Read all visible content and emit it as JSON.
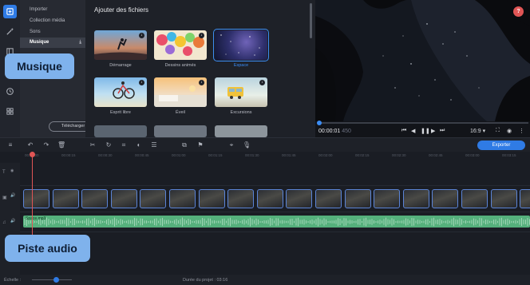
{
  "sidebar": {
    "icons": [
      "import-icon",
      "magic-wand-icon",
      "film-icon",
      "sticker-icon",
      "clock-icon",
      "grid-icon"
    ],
    "menu": [
      {
        "label": "Importer"
      },
      {
        "label": "Collection média"
      },
      {
        "label": "Sons"
      },
      {
        "label": "Musique",
        "active": true
      }
    ],
    "upload_button": "Télécharger"
  },
  "library": {
    "title": "Ajouter des fichiers",
    "tiles": [
      {
        "label": "Démarrage"
      },
      {
        "label": "Dessins animés"
      },
      {
        "label": "Espace",
        "selected": true
      },
      {
        "label": "Esprit libre"
      },
      {
        "label": "Éveil"
      },
      {
        "label": "Excursions"
      }
    ]
  },
  "player": {
    "help": "?",
    "time": "00:00:01",
    "ms": "450",
    "aspect": "16:9"
  },
  "toolbar": {
    "export_label": "Exporter"
  },
  "ruler": {
    "ticks": [
      "00:00:00",
      "00:00:15",
      "00:00:30",
      "00:00:45",
      "00:01:00",
      "00:01:15",
      "00:01:30",
      "00:01:45",
      "00:02:00",
      "00:02:15",
      "00:02:30",
      "00:02:45",
      "00:03:00",
      "00:03:15"
    ]
  },
  "timeline": {
    "audio_clip_name": "Space.mp3"
  },
  "status": {
    "scale_label": "Échelle :",
    "duration_label": "Durée du projet : 03:16"
  },
  "callouts": {
    "music": "Musique",
    "audio_track": "Piste audio"
  },
  "colors": {
    "accent": "#2f7be5",
    "audio_track": "#55b07c",
    "callout": "#7fb2ec",
    "playhead": "#e05555"
  }
}
